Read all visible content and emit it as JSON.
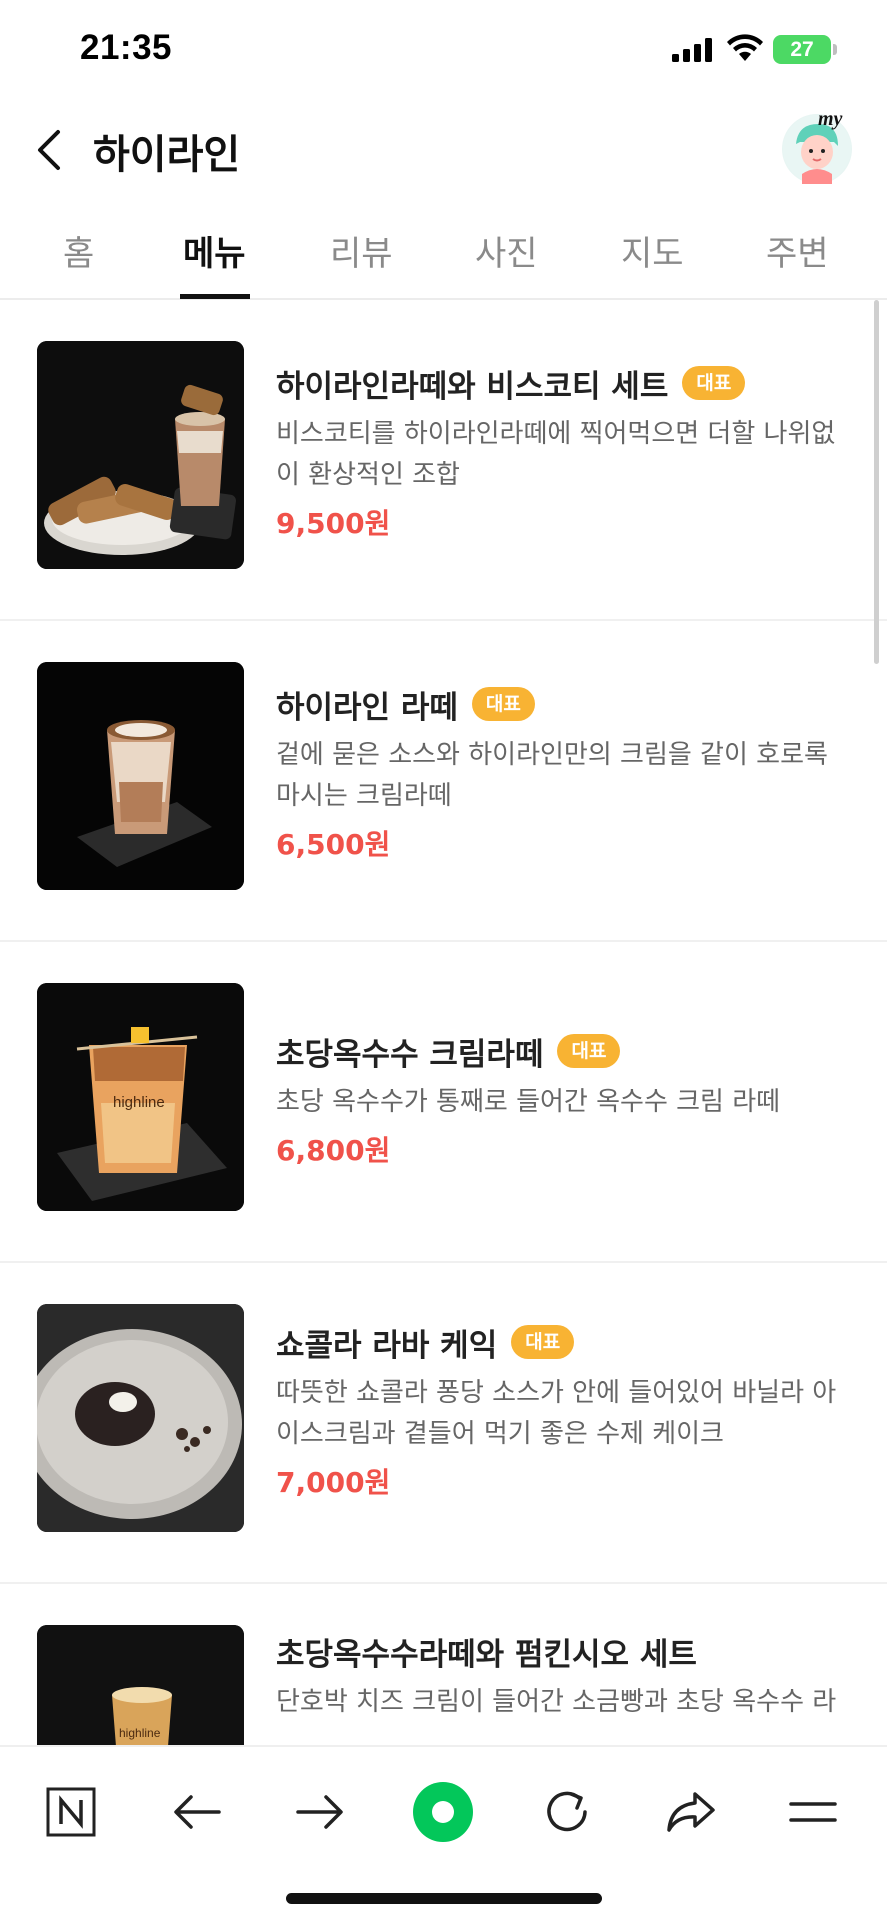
{
  "status_bar": {
    "time": "21:35",
    "battery": "27"
  },
  "header": {
    "title": "하이라인",
    "avatar_label": "my"
  },
  "tabs": [
    {
      "label": "홈"
    },
    {
      "label": "메뉴",
      "active": true
    },
    {
      "label": "리뷰"
    },
    {
      "label": "사진"
    },
    {
      "label": "지도"
    },
    {
      "label": "주변"
    }
  ],
  "menu": {
    "items": [
      {
        "name": "하이라인라떼와 비스코티 세트",
        "badge": "대표",
        "desc_line1": "비스코티를 하이라인라떼에 찍어먹으면 더할 나위없",
        "desc_line2": "이 환상적인 조합",
        "price": "9,500원"
      },
      {
        "name": "하이라인 라떼",
        "badge": "대표",
        "desc_line1": "겉에 묻은 소스와 하이라인만의 크림을 같이 호로록",
        "desc_line2": "마시는 크림라떼",
        "price": "6,500원"
      },
      {
        "name": "초당옥수수 크림라떼",
        "badge": "대표",
        "desc_line1": "초당 옥수수가 통째로 들어간 옥수수 크림 라떼",
        "price": "6,800원",
        "cup_text": "highline"
      },
      {
        "name": "쇼콜라 라바 케익",
        "badge": "대표",
        "desc_line1": "따뜻한 쇼콜라 퐁당 소스가 안에 들어있어 바닐라 아",
        "desc_line2": "이스크림과 곁들어 먹기 좋은 수제 케이크",
        "price": "7,000원"
      },
      {
        "name": "초당옥수수라떼와 펌킨시오 세트",
        "desc_line1": "단호박 치즈 크림이 들어간 소금빵과 초당 옥수수 라",
        "cup_text": "highline"
      }
    ]
  },
  "toolbar": {
    "icons": [
      "naver-home-icon",
      "back-arrow-icon",
      "forward-arrow-icon",
      "green-dot-icon",
      "refresh-icon",
      "share-icon",
      "menu-icon"
    ],
    "accent": "#03c75a"
  },
  "colors": {
    "price": "#f0524a",
    "badge": "#f8b333"
  }
}
